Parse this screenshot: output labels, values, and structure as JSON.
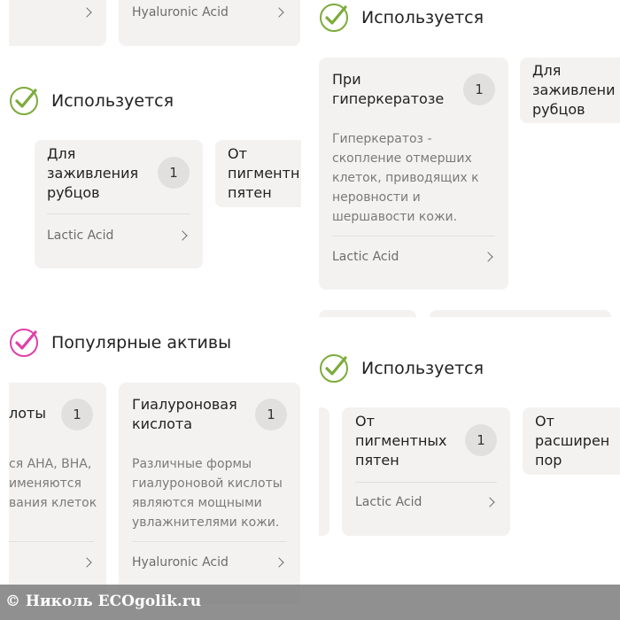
{
  "colors": {
    "card_bg": "#f4f2f1",
    "check_green": "#7cab3a",
    "check_pink": "#e040a8",
    "badge_bg": "#e2e0df"
  },
  "icons": {
    "check_used": "check-circle-green-icon",
    "check_popular": "check-circle-pink-icon",
    "chevron": "chevron-right-icon"
  },
  "top_left": {
    "card_right": {
      "ingredient": "Hyaluronic Acid"
    },
    "section": {
      "title": "Используется"
    },
    "cards": [
      {
        "title_lines": [
          "Для",
          "заживления",
          "рубцов"
        ],
        "count": "1",
        "ingredient": "Lactic Acid"
      },
      {
        "title_lines": [
          "От",
          "пигментн",
          "пятен"
        ]
      }
    ]
  },
  "top_right": {
    "section": {
      "title": "Используется"
    },
    "cards": [
      {
        "title_lines": [
          "При",
          "гиперкератозе"
        ],
        "count": "1",
        "desc_lines": [
          "Гиперкератоз -",
          "скопление отмерших",
          "клеток, приводящих к",
          "неровности и",
          "шершавости кожи."
        ],
        "ingredient": "Lactic Acid"
      },
      {
        "title_lines": [
          "Для",
          "заживлени",
          "рубцов"
        ]
      }
    ]
  },
  "bottom_left": {
    "section": {
      "title": "Популярные активы"
    },
    "cards": [
      {
        "title_lines": [
          "лоты"
        ],
        "count": "1",
        "desc_lines": [
          "ся AHA, BHA,",
          "именяются",
          "вания клеток"
        ]
      },
      {
        "title_lines": [
          "Гиалуроновая",
          "кислота"
        ],
        "count": "1",
        "desc_lines": [
          "Различные формы",
          "гиалуроновой кислоты",
          "являются мощными",
          "увлажнителями кожи."
        ],
        "ingredient": "Hyaluronic Acid"
      }
    ]
  },
  "bottom_right": {
    "section": {
      "title": "Используется"
    },
    "cards": [
      {
        "title_lines": [
          "От",
          "пигментных",
          "пятен"
        ],
        "count": "1",
        "ingredient": "Lactic Acid"
      },
      {
        "title_lines": [
          "От",
          "расширен",
          "пор"
        ]
      }
    ]
  },
  "watermark": {
    "text": "© Николь ECOgolik.ru"
  }
}
